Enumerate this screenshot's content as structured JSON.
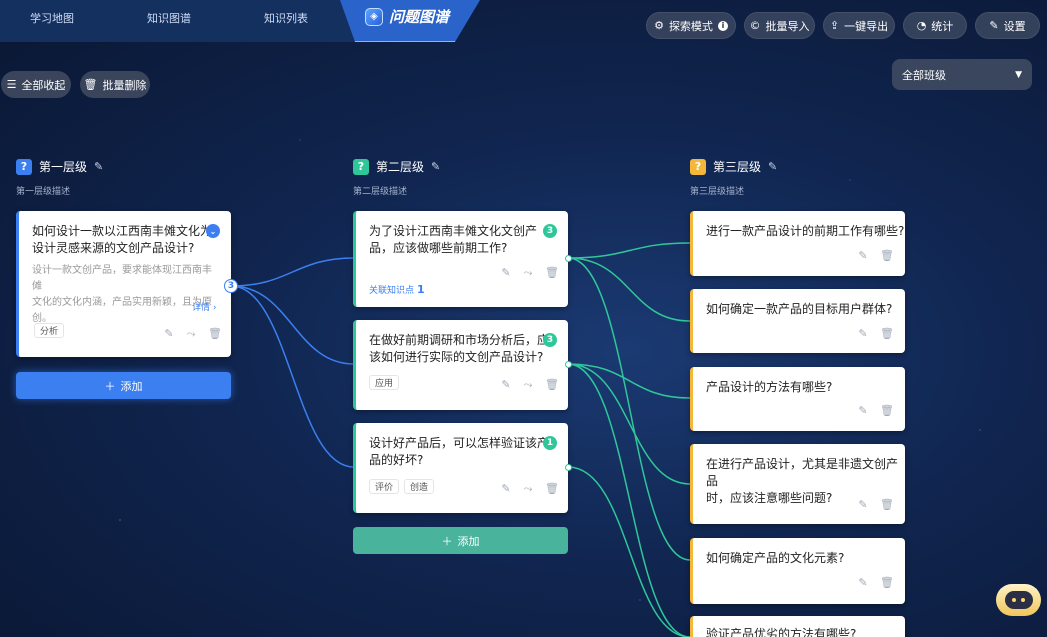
{
  "nav": {
    "tabs": [
      "学习地图",
      "知识图谱",
      "知识列表"
    ],
    "active_tab": "问题图谱"
  },
  "toolbar": {
    "explore": "探索模式",
    "batch_import": "批量导入",
    "export": "一键导出",
    "stats": "统计",
    "settings": "设置"
  },
  "actions": {
    "collapse_all": "全部收起",
    "batch_delete": "批量删除"
  },
  "class_select": {
    "value": "全部班级"
  },
  "levels": [
    {
      "name": "第一层级",
      "desc": "第一层级描述",
      "color": "#3b7ff0"
    },
    {
      "name": "第二层级",
      "desc": "第二层级描述",
      "color": "#2fc79a"
    },
    {
      "name": "第三层级",
      "desc": "第三层级描述",
      "color": "#f5b73a"
    }
  ],
  "level1": {
    "card": {
      "title_line1": "如何设计一款以江西南丰傩文化为",
      "title_line2": "设计灵感来源的文创产品设计?",
      "desc_line1": "设计一款文创产品，要求能体现江西南丰傩",
      "desc_line2": "文化的文化内涵，产品实用新颖，且为原",
      "desc_line3": "创。",
      "detail": "详情 ›",
      "tag": "分析",
      "children_count": "3"
    },
    "add": "添加"
  },
  "level2": {
    "cards": [
      {
        "line1": "为了设计江西南丰傩文化文创产",
        "line2": "品，应该做哪些前期工作?",
        "count": "3",
        "link_label": "关联知识点",
        "link_count": "1"
      },
      {
        "line1": "在做好前期调研和市场分析后，应",
        "line2": "该如何进行实际的文创产品设计?",
        "count": "3",
        "tag": "应用"
      },
      {
        "line1": "设计好产品后，可以怎样验证该产",
        "line2": "品的好坏?",
        "count": "1",
        "tag1": "评价",
        "tag2": "创造"
      }
    ],
    "add": "添加"
  },
  "level3": {
    "cards": [
      {
        "line1": "进行一款产品设计的前期工作有哪些?"
      },
      {
        "line1": "如何确定一款产品的目标用户群体?"
      },
      {
        "line1": "产品设计的方法有哪些?"
      },
      {
        "line1": "在进行产品设计，尤其是非遗文创产品",
        "line2": "时，应该注意哪些问题?"
      },
      {
        "line1": "如何确定产品的文化元素?"
      },
      {
        "line1": "验证产品优劣的方法有哪些?"
      }
    ]
  }
}
